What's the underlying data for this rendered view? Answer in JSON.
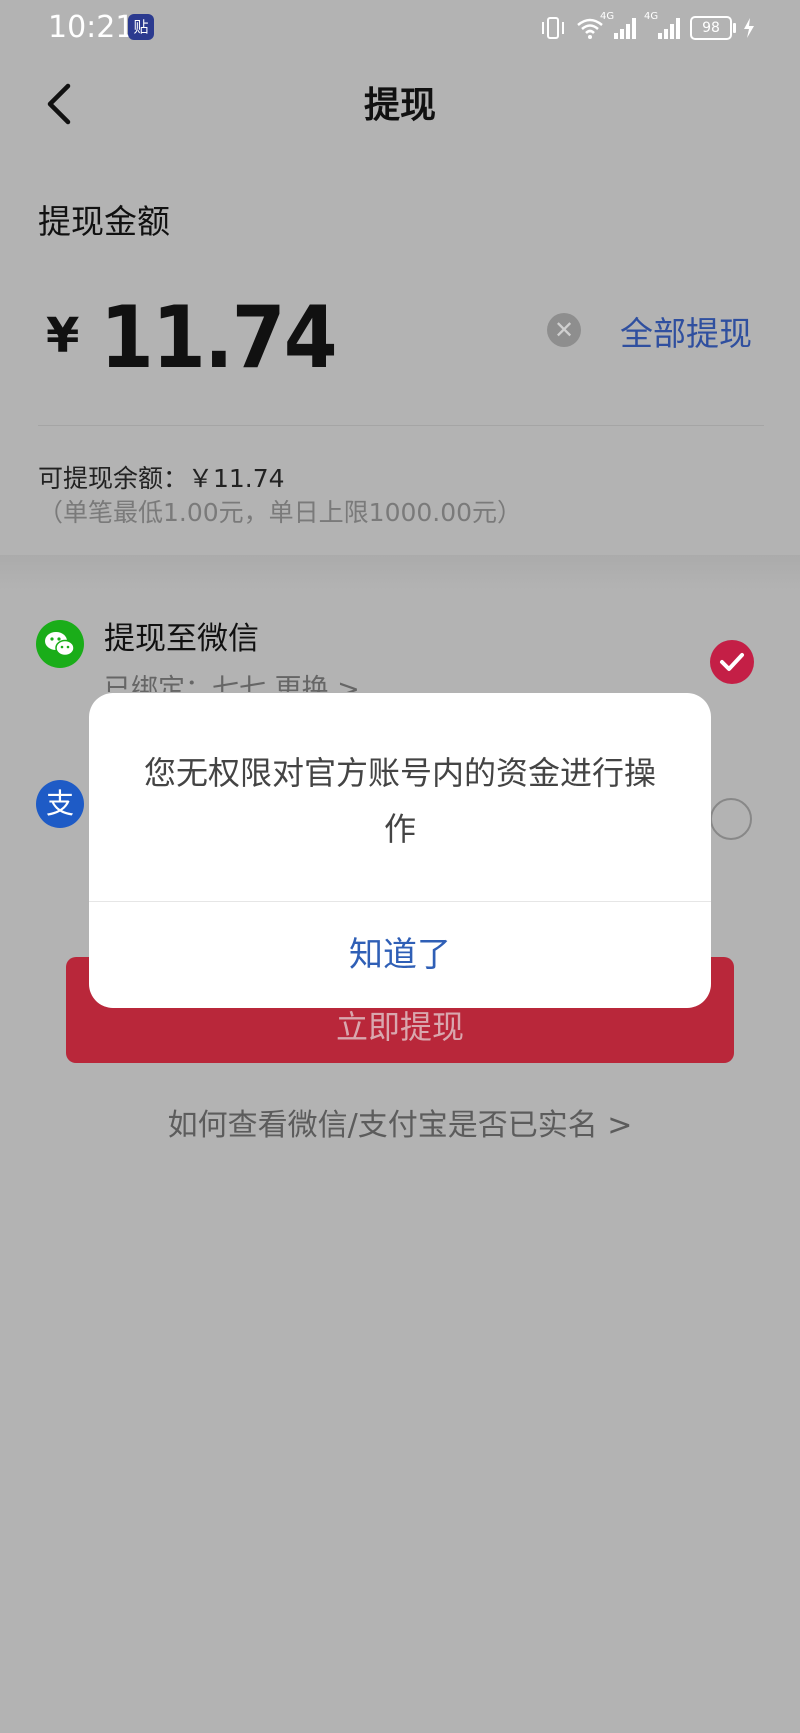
{
  "status_bar": {
    "time": "10:21",
    "app_badge": "贴",
    "network_label_1": "4G",
    "network_label_2": "4G",
    "battery": "98"
  },
  "header": {
    "title": "提现"
  },
  "amount_section": {
    "label": "提现金额",
    "currency": "¥",
    "amount": "11.74",
    "withdraw_all": "全部提现"
  },
  "balance": {
    "text": "可提现余额：￥11.74",
    "limit": "（单笔最低1.00元，单日上限1000.00元）"
  },
  "methods": {
    "wechat": {
      "label": "提现至微信",
      "bound": "已绑定：七七  更换 >"
    },
    "alipay": {
      "icon_glyph": "支"
    }
  },
  "submit_label": "立即提现",
  "help_link": "如何查看微信/支付宝是否已实名 >",
  "dialog": {
    "message": "您无权限对官方账号内的资金进行操作",
    "button": "知道了"
  },
  "colors": {
    "accent_blue": "#2f5fb6",
    "wechat_green": "#1aad19",
    "alipay_blue": "#1e5bc6",
    "brand_red": "#c41f46"
  }
}
